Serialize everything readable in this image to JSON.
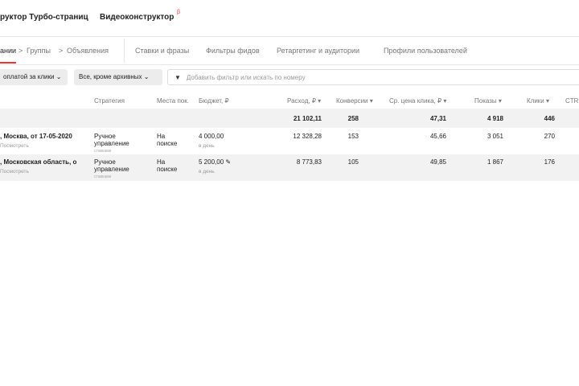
{
  "top_nav": {
    "item1": "руктор Турбо-страниц",
    "item2": "Видеоконструктор",
    "badge": "β"
  },
  "tabs": {
    "campaigns": "ании",
    "groups": "Группы",
    "ads": "Объявления",
    "bids": "Ставки и фразы",
    "feeds": "Фильтры фидов",
    "retargeting": "Ретаргетинг и аудитории",
    "profiles": "Профили пользователей",
    "sep": ">"
  },
  "filters": {
    "payment": "оплатой за клики",
    "archive": "Все, кроме архивных",
    "search_placeholder": "Добавить фильтр или искать по номеру"
  },
  "columns": {
    "strategy": "Стратегия",
    "places": "Места пок.",
    "budget": "Бюджет, ₽",
    "spend": "Расход, ₽",
    "conversions": "Конверсии",
    "cpc": "Ср. цена клика, ₽",
    "shows": "Показы",
    "clicks": "Клики",
    "ctr": "CTR"
  },
  "totals": {
    "spend": "21 102,11",
    "conversions": "258",
    "cpc": "47,31",
    "shows": "4 918",
    "clicks": "446"
  },
  "rows": [
    {
      "name": ", Москва, от 17-05-2020",
      "link": "Посмотреть",
      "strategy": "Ручное",
      "strategy2": "управление",
      "strategy3": "ставками",
      "places": "На",
      "places2": "поиске",
      "budget": "4 000,00",
      "budget_period": "в день",
      "spend": "12 328,28",
      "conversions": "153",
      "cpc": "45,66",
      "shows": "3 051",
      "clicks": "270"
    },
    {
      "name": ", Московская область, о",
      "link": "Посмотреть",
      "strategy": "Ручное",
      "strategy2": "управление",
      "strategy3": "ставками",
      "places": "На",
      "places2": "поиске",
      "budget": "5 200,00",
      "budget_period": "в день",
      "spend": "8 773,83",
      "conversions": "105",
      "cpc": "49,85",
      "shows": "1 867",
      "clicks": "176"
    }
  ]
}
